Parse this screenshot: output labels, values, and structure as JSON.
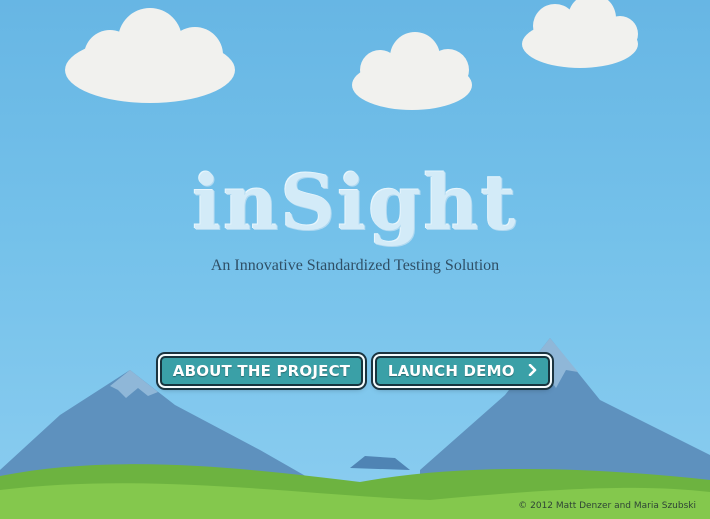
{
  "app": {
    "title": "inSight",
    "subtitle": "An Innovative Standardized Testing Solution"
  },
  "buttons": {
    "about_label": "ABOUT THE PROJECT",
    "launch_label": "LAUNCH DEMO",
    "launch_icon": "chevron-right-icon"
  },
  "footer": {
    "copyright": "© 2012 Matt Denzer and Maria Szubski"
  },
  "colors": {
    "sky": "#74c1ea",
    "button": "#3aa0a7",
    "hills": "#7fc44a",
    "mountains": "#5b8fbd",
    "clouds": "#f2f2f0"
  }
}
